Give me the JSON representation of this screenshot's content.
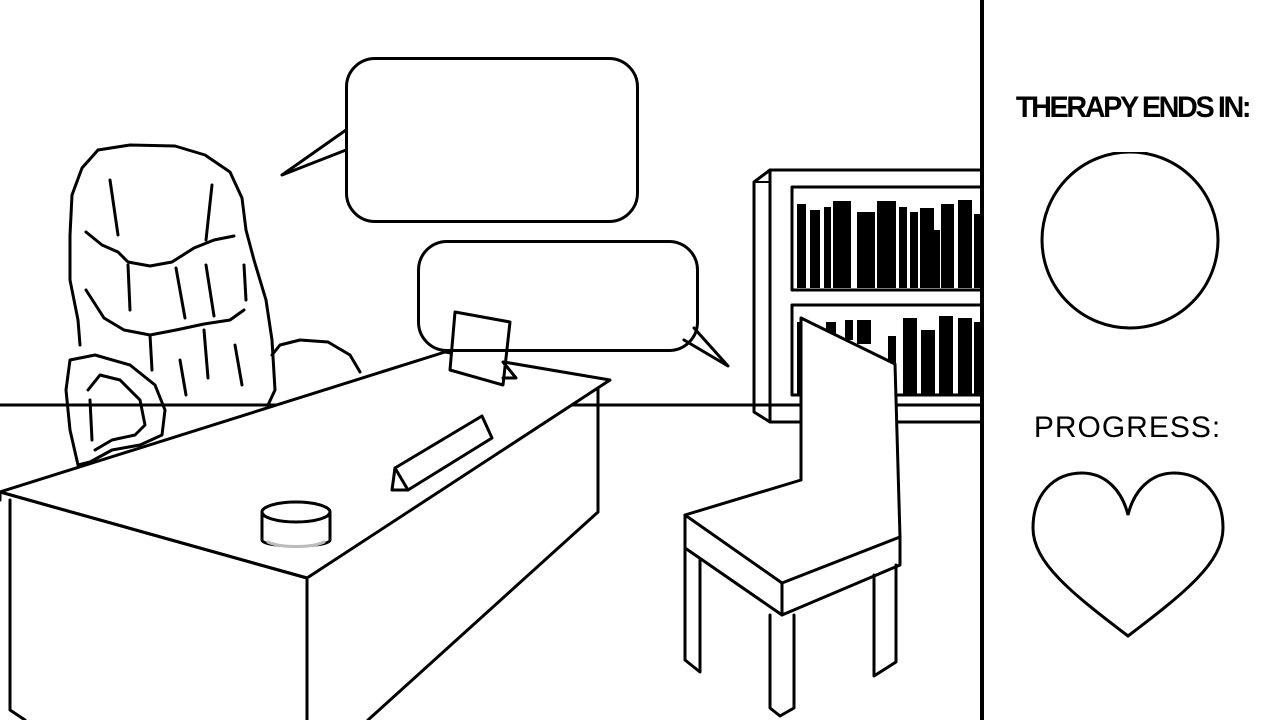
{
  "hud": {
    "timer_label": "THERAPY ENDS IN:",
    "timer_value": "",
    "progress_label": "PROGRESS:",
    "progress_fill": 0
  },
  "dialogue": {
    "therapist_text": "",
    "patient_text": ""
  },
  "icons": {
    "timer": "circle-timer-icon",
    "progress": "heart-icon"
  },
  "colors": {
    "ink": "#000000",
    "background": "#ffffff"
  }
}
